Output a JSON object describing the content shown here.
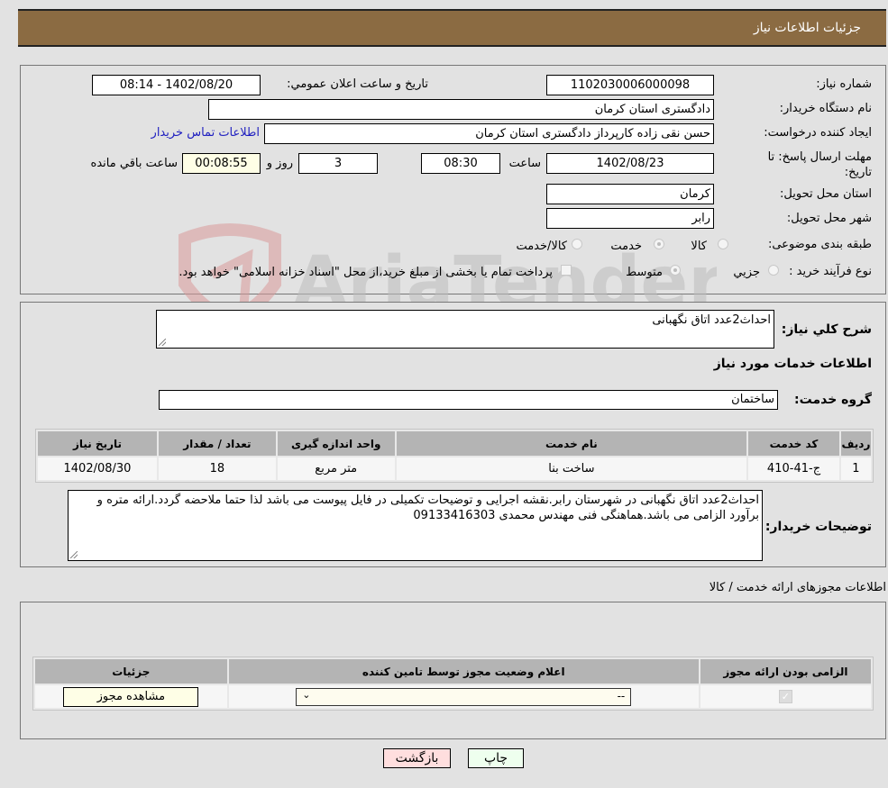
{
  "header": {
    "title": "جزئیات اطلاعات نیاز"
  },
  "details": {
    "need_number_label": "شماره نیاز:",
    "need_number": "1102030006000098",
    "announce_label": "تاریخ و ساعت اعلان عمومي:",
    "announce_value": "1402/08/20 - 08:14",
    "buyer_org_label": "نام دستگاه خریدار:",
    "buyer_org": "دادگستری استان کرمان",
    "creator_label": "ایجاد کننده درخواست:",
    "creator": "حسن نقی زاده کارپرداز دادگستری استان کرمان",
    "contact_link": "اطلاعات تماس خریدار",
    "deadline_label": "مهلت ارسال پاسخ: تا تاریخ:",
    "deadline_date": "1402/08/23",
    "time_label": "ساعت",
    "deadline_time": "08:30",
    "days": "3",
    "days_label": "روز و",
    "remaining": "00:08:55",
    "remaining_label": "ساعت باقي مانده",
    "province_label": "استان محل تحویل:",
    "province": "کرمان",
    "city_label": "شهر محل تحویل:",
    "city": "رابر",
    "category_label": "طبقه بندی موضوعی:",
    "category_options": [
      {
        "label": "کالا",
        "selected": false
      },
      {
        "label": "خدمت",
        "selected": true
      },
      {
        "label": "کالا/خدمت",
        "selected": false
      }
    ],
    "process_label": "نوع فرآیند خرید :",
    "process_options": [
      {
        "label": "جزيي",
        "selected": false
      },
      {
        "label": "متوسط",
        "selected": true
      }
    ],
    "treasury_note": "پرداخت تمام یا بخشی از مبلغ خرید،از محل \"اسناد خزانه اسلامی\" خواهد بود.",
    "treasury_checked": false
  },
  "watermark": {
    "text": "AriaTender.neT"
  },
  "summary": {
    "desc_label": "شرح کلي نياز:",
    "desc_value": "احداث2عدد اتاق نگهبانی",
    "services_heading": "اطلاعات خدمات مورد نیاز",
    "group_label": "گروه خدمت:",
    "group_value": "ساختمان"
  },
  "services_table": {
    "headers": [
      "ردیف",
      "کد خدمت",
      "نام خدمت",
      "واحد اندازه گیری",
      "تعداد / مقدار",
      "تاریخ نیاز"
    ],
    "rows": [
      [
        "1",
        "ج-41-410",
        "ساخت بنا",
        "متر مربع",
        "18",
        "1402/08/30"
      ]
    ]
  },
  "buyer_notes": {
    "label": "توضیحات خریدار:",
    "value": "احداث2عدد اتاق نگهبانی در شهرستان رابر.نقشه اجرایی و توضیحات تکمیلی در فایل پیوست می باشد لذا حتما ملاحضه گردد.ارائه متره و برآورد الزامی می باشد.هماهنگی فنی مهندس محمدی 09133416303"
  },
  "permits": {
    "heading": "اطلاعات مجوزهای ارائه خدمت / کالا",
    "headers": [
      "الزامی بودن ارائه مجوز",
      "اعلام وضعیت مجوز توسط تامین کننده",
      "جزئیات"
    ],
    "rows": [
      {
        "required": true,
        "status": "--",
        "details_button": "مشاهده مجوز"
      }
    ]
  },
  "actions": {
    "print": "چاپ",
    "back": "بازگشت",
    "print_color": "#eeffee",
    "back_color": "#ffdede"
  }
}
